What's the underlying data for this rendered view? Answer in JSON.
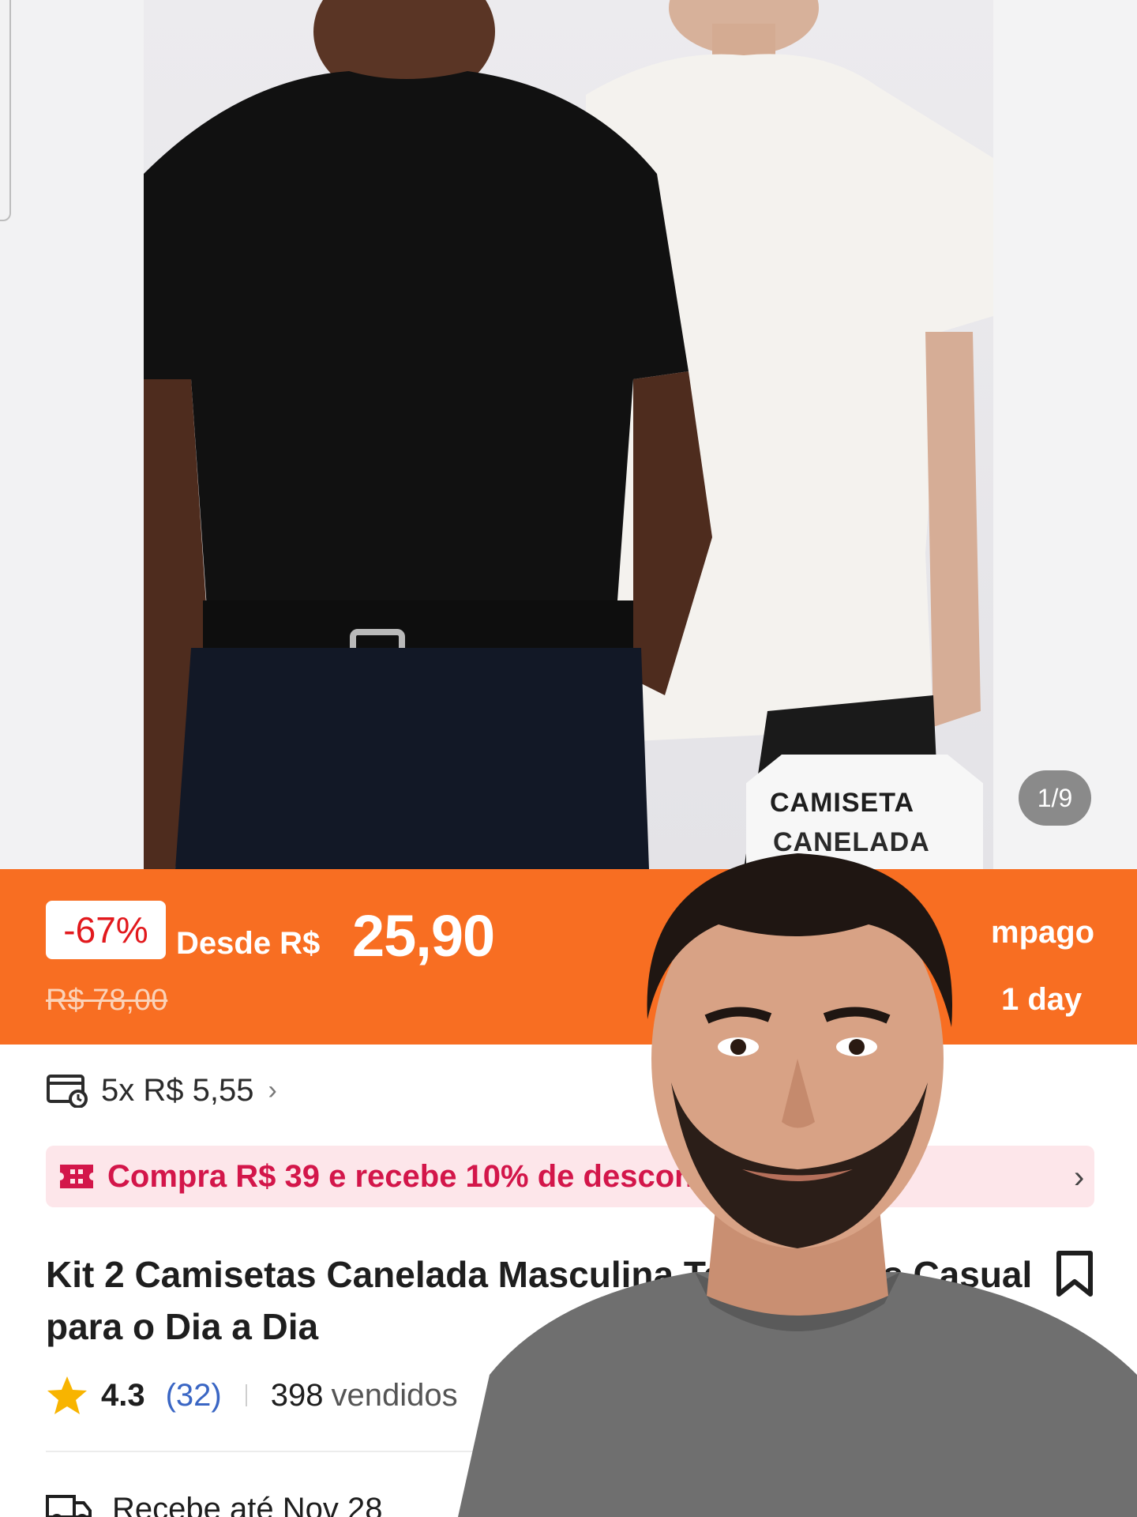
{
  "gallery": {
    "counter": "1/9",
    "brand_tag_line1": "CAMISETA",
    "brand_tag_line2": "CANELADA"
  },
  "price": {
    "discount": "-67%",
    "from_label": "Desde R$",
    "current": "25,90",
    "original": "R$ 78,00",
    "side_line1": "mpago",
    "side_line2": "1 day"
  },
  "installments": {
    "text": "5x R$ 5,55",
    "chevron": "›"
  },
  "promo": {
    "text": "Compra R$ 39 e recebe 10% de desconto com",
    "chevron": "›"
  },
  "product": {
    "title": "Kit 2 Camisetas Canelada Masculina Texturizadas Casual para o Dia a Dia"
  },
  "rating": {
    "score": "4.3",
    "reviews": "(32)",
    "sold_count": "398",
    "sold_label": "vendidos"
  },
  "delivery": {
    "text": "Recebe até Nov 28"
  },
  "colors": {
    "accent_orange": "#f86e22",
    "discount_red": "#e2191d",
    "promo_pink": "#d3164a",
    "link_blue": "#3a66c4",
    "star_yellow": "#f8b400"
  },
  "icons": [
    "card-installment-icon",
    "ticket-icon",
    "chevron-right-icon",
    "bookmark-icon",
    "star-icon",
    "truck-icon"
  ]
}
